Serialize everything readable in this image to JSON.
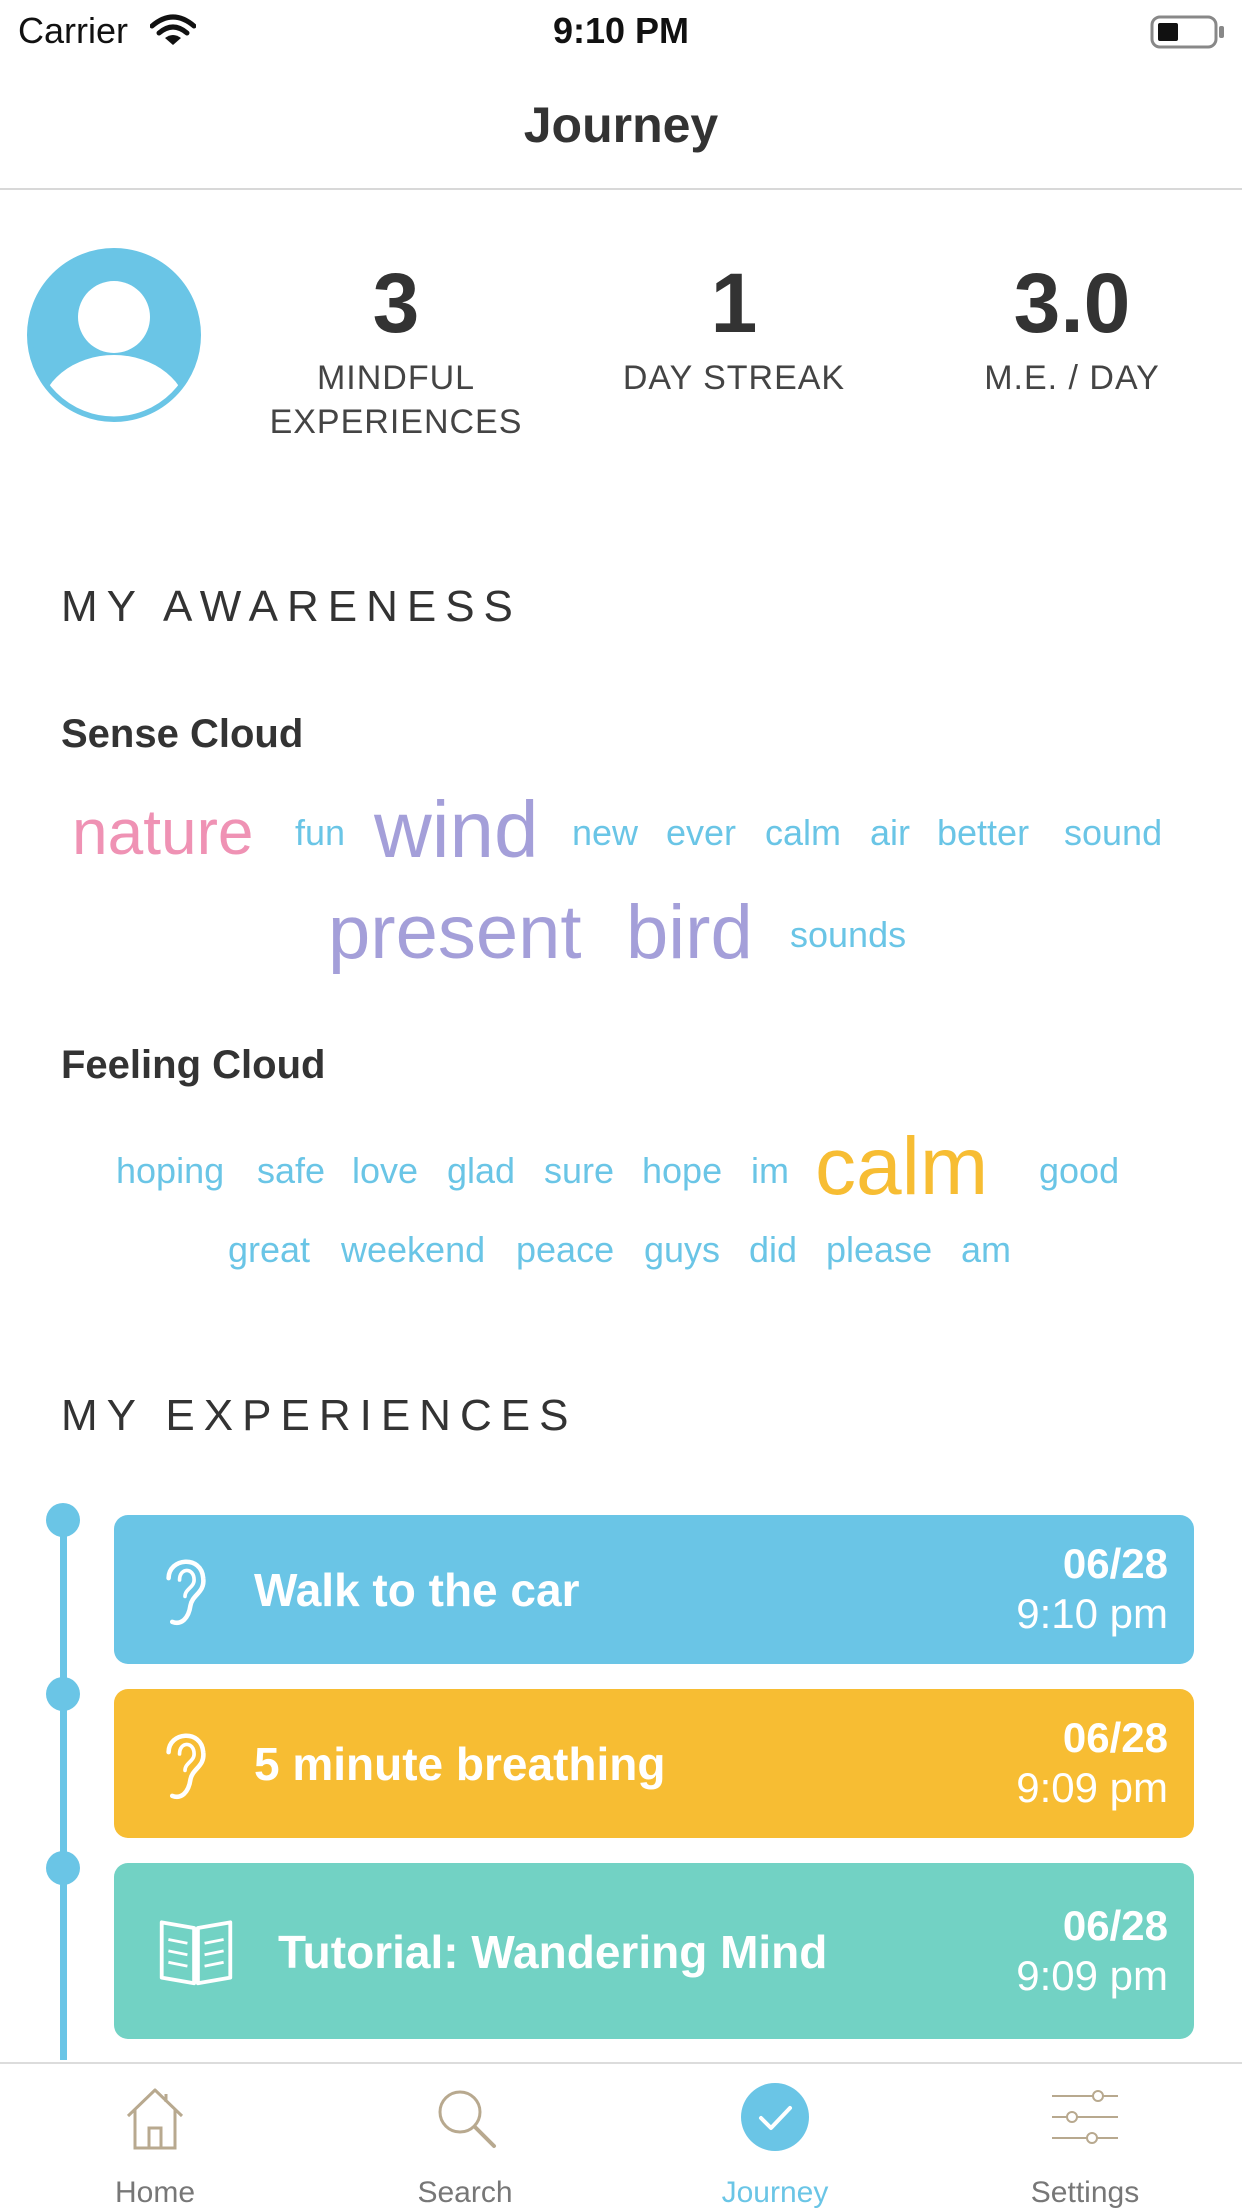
{
  "status_bar": {
    "carrier": "Carrier",
    "time": "9:10 PM"
  },
  "nav": {
    "title": "Journey"
  },
  "stats": [
    {
      "value": "3",
      "label_line1": "MINDFUL",
      "label_line2": "EXPERIENCES"
    },
    {
      "value": "1",
      "label_line1": "DAY STREAK",
      "label_line2": ""
    },
    {
      "value": "3.0",
      "label_line1": "M.E. / DAY",
      "label_line2": ""
    }
  ],
  "awareness": {
    "title": "MY AWARENESS",
    "sense_cloud": {
      "heading": "Sense Cloud",
      "words": [
        {
          "text": "nature",
          "color": "#ef92b4"
        },
        {
          "text": "fun",
          "color": "#6ac5e6"
        },
        {
          "text": "wind",
          "color": "#a49fd9"
        },
        {
          "text": "new",
          "color": "#6ac5e6"
        },
        {
          "text": "ever",
          "color": "#6ac5e6"
        },
        {
          "text": "calm",
          "color": "#6ac5e6"
        },
        {
          "text": "air",
          "color": "#6ac5e6"
        },
        {
          "text": "better",
          "color": "#6ac5e6"
        },
        {
          "text": "sound",
          "color": "#6ac5e6"
        },
        {
          "text": "present",
          "color": "#a49fd9"
        },
        {
          "text": "bird",
          "color": "#a49fd9"
        },
        {
          "text": "sounds",
          "color": "#6ac5e6"
        }
      ]
    },
    "feeling_cloud": {
      "heading": "Feeling Cloud",
      "words": [
        {
          "text": "hoping",
          "color": "#6ac5e6"
        },
        {
          "text": "safe",
          "color": "#6ac5e6"
        },
        {
          "text": "love",
          "color": "#6ac5e6"
        },
        {
          "text": "glad",
          "color": "#6ac5e6"
        },
        {
          "text": "sure",
          "color": "#6ac5e6"
        },
        {
          "text": "hope",
          "color": "#6ac5e6"
        },
        {
          "text": "im",
          "color": "#6ac5e6"
        },
        {
          "text": "calm",
          "color": "#f7bd33"
        },
        {
          "text": "good",
          "color": "#6ac5e6"
        },
        {
          "text": "great",
          "color": "#6ac5e6"
        },
        {
          "text": "weekend",
          "color": "#6ac5e6"
        },
        {
          "text": "peace",
          "color": "#6ac5e6"
        },
        {
          "text": "guys",
          "color": "#6ac5e6"
        },
        {
          "text": "did",
          "color": "#6ac5e6"
        },
        {
          "text": "please",
          "color": "#6ac5e6"
        },
        {
          "text": "am",
          "color": "#6ac5e6"
        }
      ]
    }
  },
  "experiences": {
    "title": "MY EXPERIENCES",
    "items": [
      {
        "title": "Walk to the car",
        "date": "06/28",
        "time": "9:10 pm",
        "icon": "ear-icon",
        "color": "#6ac5e6"
      },
      {
        "title": "5 minute breathing",
        "date": "06/28",
        "time": "9:09 pm",
        "icon": "ear-icon",
        "color": "#f7bd33"
      },
      {
        "title": "Tutorial: Wandering Mind",
        "date": "06/28",
        "time": "9:09 pm",
        "icon": "book-icon",
        "color": "#72d2c4"
      }
    ]
  },
  "tabbar": {
    "tabs": [
      {
        "label": "Home",
        "icon": "home-icon"
      },
      {
        "label": "Search",
        "icon": "search-icon"
      },
      {
        "label": "Journey",
        "icon": "check-circle-icon",
        "active": true
      },
      {
        "label": "Settings",
        "icon": "sliders-icon"
      }
    ]
  },
  "colors": {
    "accent": "#6ac5e6",
    "text": "#333333"
  }
}
